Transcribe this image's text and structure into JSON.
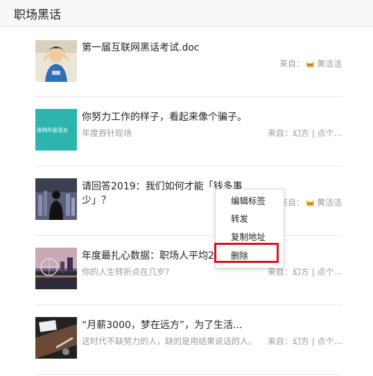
{
  "header": {
    "title": "职场黑话"
  },
  "items": [
    {
      "title": "第一届互联网黑话考试.doc",
      "subtitle": "",
      "source_label": "来自：",
      "source_name": "黄洁洁",
      "has_cat": true
    },
    {
      "title": "你努力工作的样子，看起来像个骗子。",
      "subtitle": "年度吞针现场",
      "source_label": "来自：",
      "source_name": "幻方 | 点个...",
      "has_cat": false,
      "thumb_text": "度网年度谎言"
    },
    {
      "title": "请回答2019：我们如何才能「钱多事少」？",
      "subtitle": "",
      "source_label": "来自：",
      "source_name": "黄洁洁",
      "has_cat": true
    },
    {
      "title": "年度最扎心数据：职场人平均2",
      "subtitle": "你的人生转折点在几岁?",
      "source_label": "来自：",
      "source_name": "幻方 | 点个...",
      "has_cat": false
    },
    {
      "title": "“月薪3000，梦在远方”，为了生活...",
      "subtitle": "这时代不缺努力的人，缺的是用结果说话的人。",
      "source_label": "来自：",
      "source_name": "幻方 | 点个...",
      "has_cat": false
    }
  ],
  "context_menu": {
    "items": [
      "编辑标签",
      "转发",
      "复制地址",
      "删除"
    ],
    "highlighted": "删除",
    "highlight_color": "#d9121b"
  },
  "colors": {
    "teal_thumb": "#2bb5ae",
    "muted_text": "#9a9a9a"
  }
}
